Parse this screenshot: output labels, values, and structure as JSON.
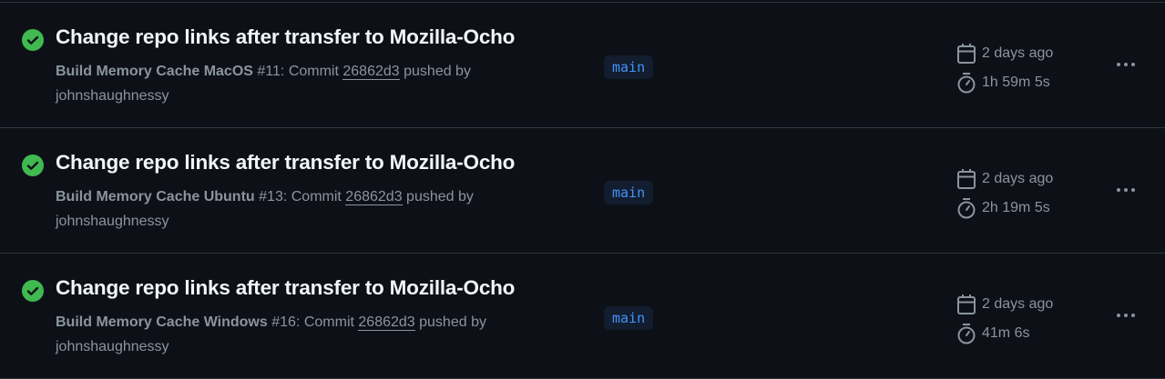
{
  "colors": {
    "success": "#3fb950",
    "branch_text": "#4493f8",
    "background": "#0d1117"
  },
  "runs": [
    {
      "status": "success",
      "title": "Change repo links after transfer to Mozilla-Ocho",
      "workflow": "Build Memory Cache MacOS",
      "run_number": "#11",
      "commit_prefix": ": Commit ",
      "sha": "26862d3",
      "pushed_by": " pushed by ",
      "user": "johnshaughnessy",
      "branch": "main",
      "date": "2 days ago",
      "duration": "1h 59m 5s"
    },
    {
      "status": "success",
      "title": "Change repo links after transfer to Mozilla-Ocho",
      "workflow": "Build Memory Cache Ubuntu",
      "run_number": "#13",
      "commit_prefix": ": Commit ",
      "sha": "26862d3",
      "pushed_by": " pushed by ",
      "user": "johnshaughnessy",
      "branch": "main",
      "date": "2 days ago",
      "duration": "2h 19m 5s"
    },
    {
      "status": "success",
      "title": "Change repo links after transfer to Mozilla-Ocho",
      "workflow": "Build Memory Cache Windows",
      "run_number": "#16",
      "commit_prefix": ": Commit ",
      "sha": "26862d3",
      "pushed_by": " pushed by ",
      "user": "johnshaughnessy",
      "branch": "main",
      "date": "2 days ago",
      "duration": "41m 6s"
    }
  ]
}
